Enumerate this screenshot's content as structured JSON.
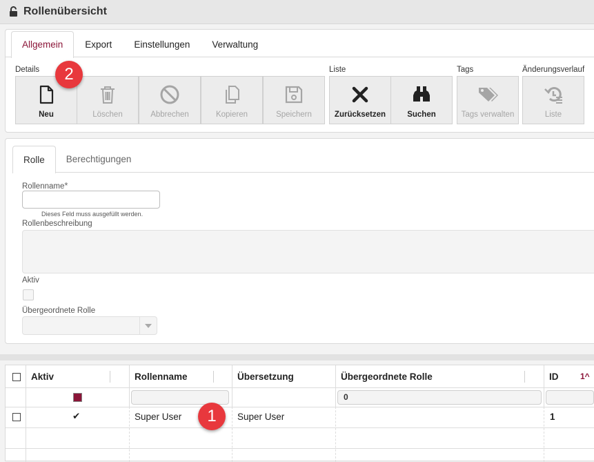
{
  "window": {
    "title": "Rollenübersicht",
    "icon": "unlock-icon"
  },
  "menu_tabs": [
    {
      "label": "Allgemein",
      "active": true
    },
    {
      "label": "Export",
      "active": false
    },
    {
      "label": "Einstellungen",
      "active": false
    },
    {
      "label": "Verwaltung",
      "active": false
    }
  ],
  "toolbar": {
    "groups": {
      "details": "Details",
      "liste": "Liste",
      "tags": "Tags",
      "history": "Änderungsverlauf"
    },
    "buttons": {
      "neu": {
        "label": "Neu",
        "icon": "document-icon",
        "enabled": true
      },
      "loeschen": {
        "label": "Löschen",
        "icon": "trash-icon",
        "enabled": false
      },
      "abbrechen": {
        "label": "Abbrechen",
        "icon": "cancel-icon",
        "enabled": false
      },
      "kopieren": {
        "label": "Kopieren",
        "icon": "copy-icon",
        "enabled": false
      },
      "speichern": {
        "label": "Speichern",
        "icon": "save-icon",
        "enabled": false
      },
      "zuruecksetzen": {
        "label": "Zurücksetzen",
        "icon": "close-x-icon",
        "enabled": true
      },
      "suchen": {
        "label": "Suchen",
        "icon": "binoculars-icon",
        "enabled": true
      },
      "tags": {
        "label": "Tags verwalten",
        "icon": "tags-icon",
        "enabled": false
      },
      "history": {
        "label": "Liste",
        "icon": "history-list-icon",
        "enabled": false
      }
    }
  },
  "markers": {
    "toolbar_marker": "2",
    "grid_marker": "1"
  },
  "form": {
    "tabs": [
      {
        "label": "Rolle",
        "active": true
      },
      {
        "label": "Berechtigungen",
        "active": false
      }
    ],
    "rollenname": {
      "label": "Rollenname",
      "required_mark": "*",
      "value": "",
      "hint": "Dieses Feld muss ausgefüllt werden."
    },
    "rollenbeschreibung": {
      "label": "Rollenbeschreibung",
      "value": ""
    },
    "aktiv": {
      "label": "Aktiv",
      "checked": false
    },
    "uebergeordnete_rolle": {
      "label": "Übergeordnete Rolle",
      "value": ""
    }
  },
  "grid": {
    "headers": {
      "aktiv": "Aktiv",
      "rollenname": "Rollenname",
      "uebersetzung": "Übersetzung",
      "uebergeordnete_rolle": "Übergeordnete Rolle",
      "id": "ID",
      "sort_indicator": "1^"
    },
    "filters": {
      "aktiv_color": "#8b1538",
      "uebergeordnete_rolle": "0"
    },
    "rows": [
      {
        "aktiv": "✔",
        "rollenname": "Super User",
        "uebersetzung": "Super User",
        "uebergeordnete_rolle": "",
        "id": "1"
      }
    ]
  },
  "colors": {
    "accent": "#8b1538",
    "marker": "#e8383d"
  }
}
